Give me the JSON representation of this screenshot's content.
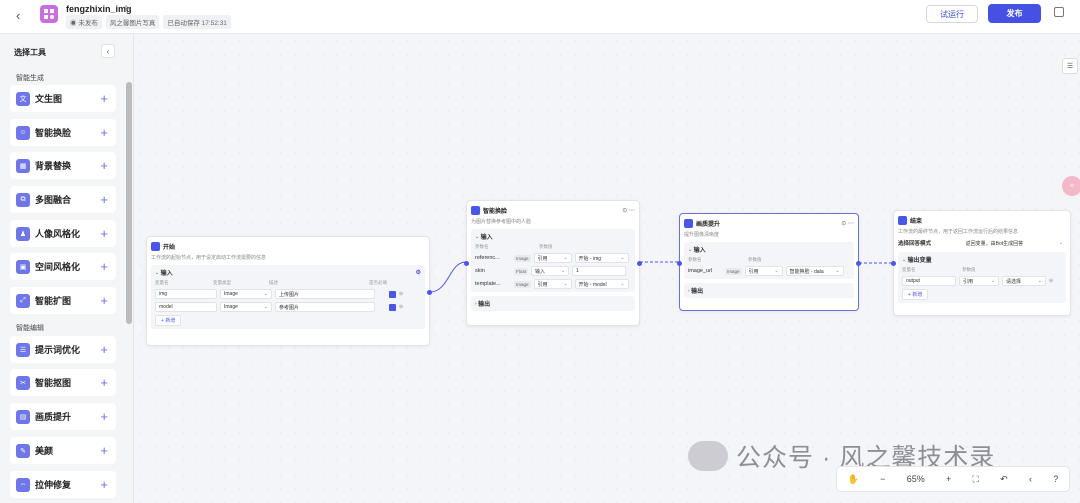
{
  "header": {
    "back_icon": "chevron-left-icon",
    "app_name": "fengzhixin_img",
    "status_unpublished": "未发布",
    "tag": "风之馨图片写真",
    "autosave": "已自动保存 17:52:31",
    "trial_run": "试运行",
    "publish": "发布"
  },
  "sidebar": {
    "title": "选择工具",
    "section_gen": "智能生成",
    "section_edit": "智能编辑",
    "tools": [
      {
        "label": "文生图",
        "icon": "文"
      },
      {
        "label": "智能换脸",
        "icon": "☺"
      },
      {
        "label": "背景替换",
        "icon": "▦"
      },
      {
        "label": "多图融合",
        "icon": "⧉"
      },
      {
        "label": "人像风格化",
        "icon": "♟"
      },
      {
        "label": "空间风格化",
        "icon": "▣"
      },
      {
        "label": "智能扩图",
        "icon": "⤢"
      },
      {
        "label": "提示词优化",
        "icon": "☰"
      },
      {
        "label": "智能抠图",
        "icon": "✂"
      },
      {
        "label": "画质提升",
        "icon": "▤"
      },
      {
        "label": "美颜",
        "icon": "✎"
      },
      {
        "label": "拉伸修复",
        "icon": "⇔"
      }
    ]
  },
  "nodes": {
    "start": {
      "title": "开始",
      "desc": "工作流的起始节点，用于设定启动工作流需要的信息",
      "input_label": "输入",
      "cols": [
        "变量名",
        "变量类型",
        "描述",
        "是否必填"
      ],
      "rows": [
        {
          "name": "img",
          "type": "Image",
          "desc": "上传图片"
        },
        {
          "name": "model",
          "type": "Image",
          "desc": "参考图片"
        }
      ],
      "add": "新增"
    },
    "faceswap": {
      "title": "智能换脸",
      "desc": "为图片替换参考图中的人脸",
      "input_label": "输入",
      "cols": [
        "参数名",
        "参数值"
      ],
      "rows": [
        {
          "name": "referenc...",
          "tag": "Image",
          "mode": "引用",
          "val": "开始 - img"
        },
        {
          "name": "skin",
          "tag": "Float",
          "mode": "输入",
          "val": "1"
        },
        {
          "name": "template...",
          "tag": "Image",
          "mode": "引用",
          "val": "开始 - model"
        }
      ],
      "output_label": "输出"
    },
    "enhance": {
      "title": "画质提升",
      "desc": "提升图像清晰度",
      "input_label": "输入",
      "cols": [
        "参数名",
        "参数值"
      ],
      "rows": [
        {
          "name": "image_url",
          "tag": "Image",
          "mode": "引用",
          "val": "智能换脸 - data"
        }
      ],
      "output_label": "输出"
    },
    "end": {
      "title": "结束",
      "desc": "工作流的最终节点，用于返回工作流运行后的结果信息",
      "mode_label": "选择回答模式",
      "mode_value": "返回变量，由Bot生成回答",
      "output_label": "输出变量",
      "cols": [
        "变量名",
        "参数值"
      ],
      "rows": [
        {
          "name": "output",
          "mode": "引用",
          "val": "请选择"
        }
      ],
      "add": "新增"
    }
  },
  "toolbar": {
    "zoom": "65%",
    "icons": [
      "hand-icon",
      "zoom-out-icon",
      "zoom-in-icon",
      "fit-icon",
      "undo-icon",
      "redo-icon",
      "help-icon"
    ]
  },
  "watermark": "公众号 · 风之馨技术录",
  "colors": {
    "accent": "#4651e3",
    "selected_border": "#6a6fe0",
    "app_icon": "#c86ee0"
  }
}
